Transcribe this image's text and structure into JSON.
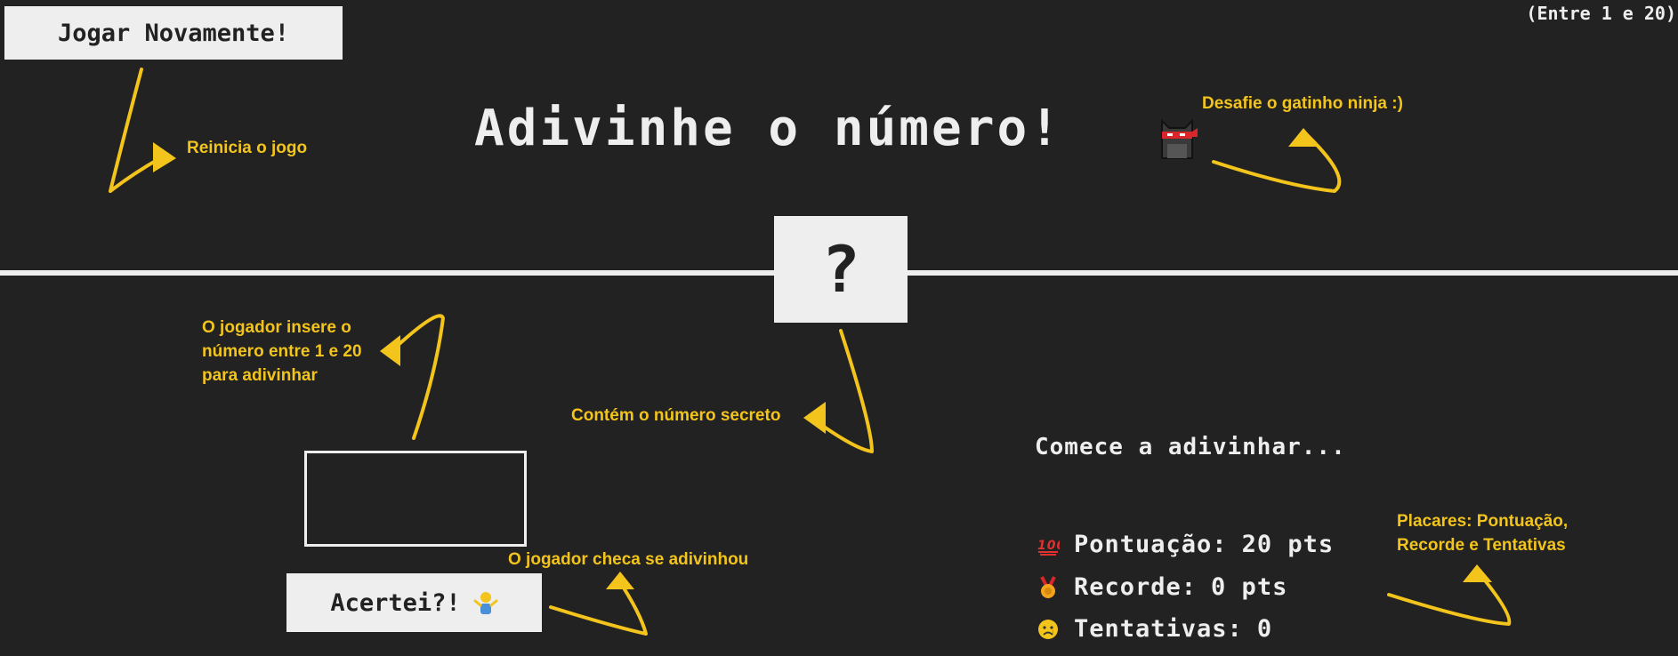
{
  "header": {
    "again_label": "Jogar Novamente!",
    "range_text": "(Entre 1 e 20)",
    "title": "Adivinhe o número!"
  },
  "secret": {
    "placeholder": "?"
  },
  "guess": {
    "value": ""
  },
  "check_label": "Acertei?!",
  "message": "Comece a adivinhar...",
  "stats": {
    "score_label": "Pontuação:",
    "score_value": "20 pts",
    "record_label": "Recorde:",
    "record_value": "0 pts",
    "tries_label": "Tentativas:",
    "tries_value": "0"
  },
  "icons": {
    "title_icon": "ninja-cat-icon",
    "check_icon": "person-shrugging-icon",
    "score_icon": "hundred-points-icon",
    "record_icon": "medal-icon",
    "tries_icon": "sad-face-icon"
  },
  "annotations": {
    "restart": "Reinicia o jogo",
    "ninja": "Desafie o gatinho ninja :)",
    "input_line1": "O jogador insere o",
    "input_line2": "número entre 1 e 20",
    "input_line3": "para adivinhar",
    "secret": "Contém o número secreto",
    "check": "O jogador checa se adivinhou",
    "stats_line1": "Placares: Pontuação,",
    "stats_line2": "Recorde e Tentativas"
  },
  "colors": {
    "background": "#222222",
    "foreground": "#eeeeee",
    "annotation": "#f2c41c"
  }
}
